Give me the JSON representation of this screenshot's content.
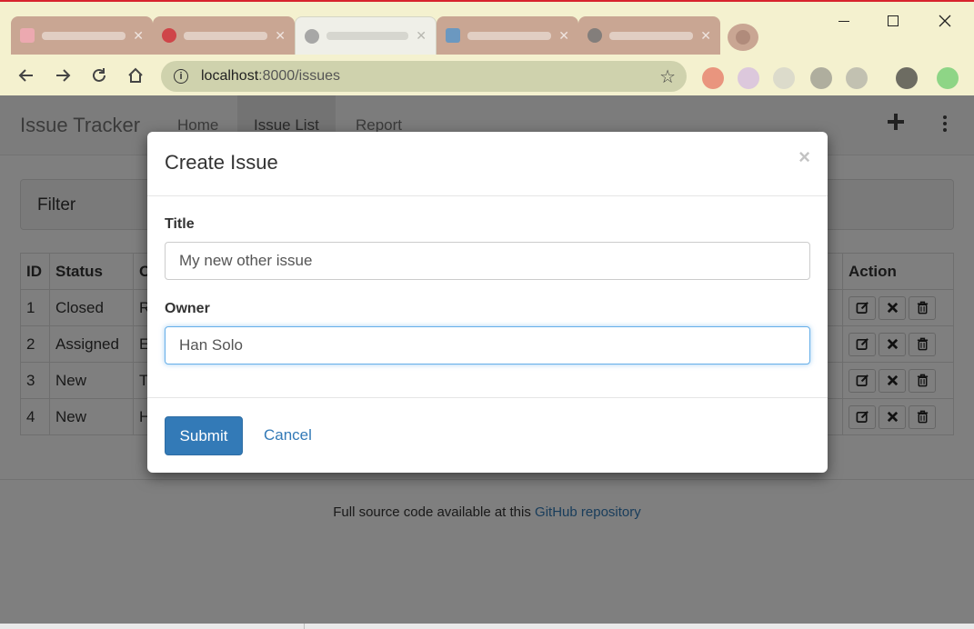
{
  "browser": {
    "url_host": "localhost",
    "url_path": ":8000/issues",
    "tab_count": 5
  },
  "app": {
    "brand": "Issue Tracker",
    "nav": {
      "home": "Home",
      "issue_list": "Issue List",
      "report": "Report"
    }
  },
  "filter": {
    "title": "Filter"
  },
  "table": {
    "headers": {
      "id": "ID",
      "status": "Status",
      "owner_initial": "O",
      "action": "Action"
    },
    "rows": [
      {
        "id": "1",
        "status": "Closed",
        "owner_initial": "R"
      },
      {
        "id": "2",
        "status": "Assigned",
        "owner_initial": "E"
      },
      {
        "id": "3",
        "status": "New",
        "owner_initial": "T"
      },
      {
        "id": "4",
        "status": "New",
        "owner_initial": "H"
      }
    ]
  },
  "footer": {
    "text": "Full source code available at this ",
    "link": "GitHub repository"
  },
  "modal": {
    "title": "Create Issue",
    "close": "×",
    "title_label": "Title",
    "title_value": "My new other issue",
    "owner_label": "Owner",
    "owner_value": "Han Solo",
    "submit": "Submit",
    "cancel": "Cancel"
  },
  "colors": {
    "primary": "#337ab7",
    "focus": "#66afe9",
    "chrome_bar": "#f4f1cf"
  }
}
